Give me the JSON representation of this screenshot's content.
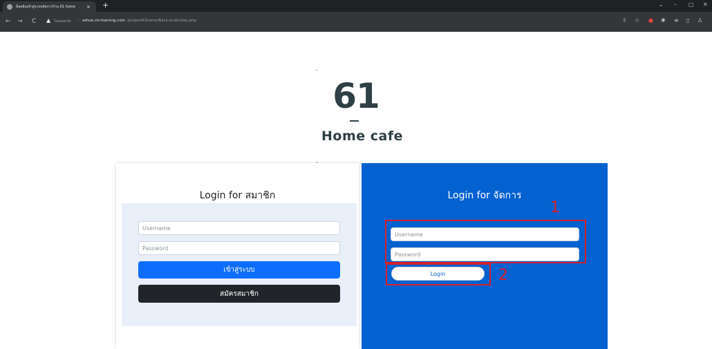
{
  "browser": {
    "tab_title": "ล็อคอินเข้าสู่ระบบจัดการร้าน 61 home",
    "tab_close": "×",
    "new_tab": "+",
    "window_controls": [
      "⌄",
      "–",
      "▢",
      "✕"
    ],
    "nav": [
      "←",
      "→",
      "C"
    ],
    "insecure_label": "ไม่ปลอดภัย",
    "url_host": "sshue.cis-training.com",
    "url_path": "/project61home/Back-end/index.php"
  },
  "logo": {
    "number": "61",
    "subtitle": "Home cafe"
  },
  "member": {
    "title": "Login for สมาชิก",
    "username_placeholder": "Username",
    "password_placeholder": "Password",
    "login_button": "เข้าสู่ระบบ",
    "register_button": "สมัครสมาชิก"
  },
  "admin": {
    "title": "Login for จัดการ",
    "username_placeholder": "Username",
    "password_placeholder": "Password",
    "login_button": "Login"
  },
  "annotations": {
    "label_1": "1",
    "label_2": "2",
    "color": "#d6212b"
  },
  "colors": {
    "admin_panel": "#0461d0",
    "primary_button": "#0d6efd",
    "dark_button": "#212529",
    "logo": "#2e3f45"
  }
}
